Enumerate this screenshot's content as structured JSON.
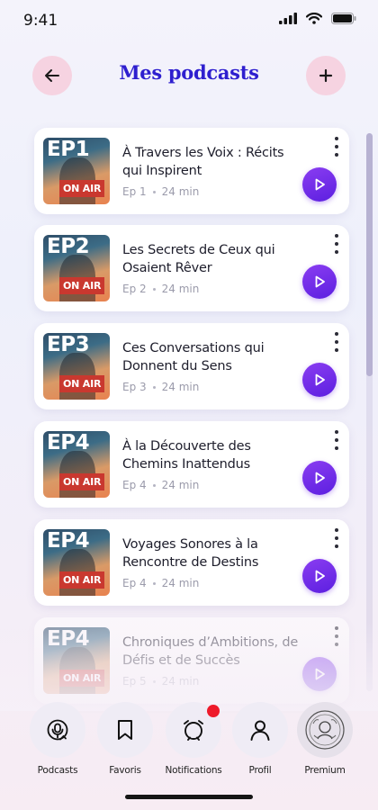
{
  "status": {
    "time": "9:41"
  },
  "header": {
    "title": "Mes podcasts"
  },
  "episodes": [
    {
      "code": "EP1",
      "badge": "ON AIR",
      "title": "À Travers les Voix : Récits qui Inspirent",
      "number": "Ep 1",
      "duration": "24 min"
    },
    {
      "code": "EP2",
      "badge": "ON AIR",
      "title": "Les Secrets de Ceux qui Osaient Rêver",
      "number": "Ep 2",
      "duration": "24 min"
    },
    {
      "code": "EP3",
      "badge": "ON AIR",
      "title": "Ces Conversations qui Donnent du Sens",
      "number": "Ep 3",
      "duration": "24 min"
    },
    {
      "code": "EP4",
      "badge": "ON AIR",
      "title": "À la Découverte des Chemins Inattendus",
      "number": "Ep 4",
      "duration": "24 min"
    },
    {
      "code": "EP4",
      "badge": "ON AIR",
      "title": "Voyages Sonores à la Rencontre de Destins",
      "number": "Ep 4",
      "duration": "24 min"
    },
    {
      "code": "EP4",
      "badge": "ON AIR",
      "title": "Chroniques d’Ambitions, de Défis et de Succès",
      "number": "Ep 5",
      "duration": "24 min"
    }
  ],
  "nav": {
    "podcasts": "Podcasts",
    "favoris": "Favoris",
    "notifications": "Notifications",
    "profil": "Profil",
    "premium": "Premium"
  },
  "colors": {
    "accent": "#2e1fcf",
    "play": "#6f2bea",
    "header_button_bg": "#f6d3e1",
    "notification_badge": "#ee1a2a"
  },
  "icons": {
    "back": "arrow-left-icon",
    "add": "plus-icon",
    "more": "more-vertical-icon",
    "play": "play-icon",
    "podcasts": "podcast-icon",
    "favoris": "bookmark-icon",
    "notifications": "alarm-clock-icon",
    "profil": "user-icon",
    "premium": "crest-emblem-icon"
  }
}
